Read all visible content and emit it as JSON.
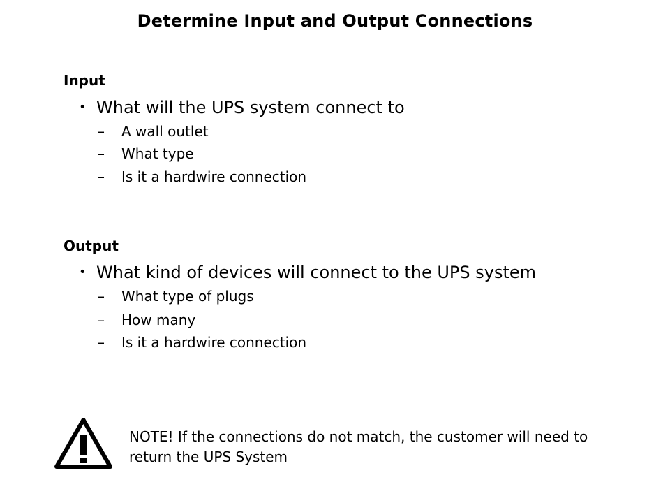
{
  "title": "Determine Input and Output Connections",
  "sections": [
    {
      "heading": "Input",
      "bullet": "What will the UPS system connect to",
      "sub_items": [
        "A wall outlet",
        "What type",
        "Is it a hardwire connection"
      ]
    },
    {
      "heading": "Output",
      "bullet": "What kind of devices will connect to the UPS system",
      "sub_items": [
        "What type of plugs",
        "How many",
        "Is it a hardwire connection"
      ]
    }
  ],
  "symbols": {
    "bullet": "•",
    "dash": "–"
  },
  "note": {
    "icon": "warning-triangle-icon",
    "text": "NOTE! If the connections do not match, the customer will need to return the UPS System"
  }
}
